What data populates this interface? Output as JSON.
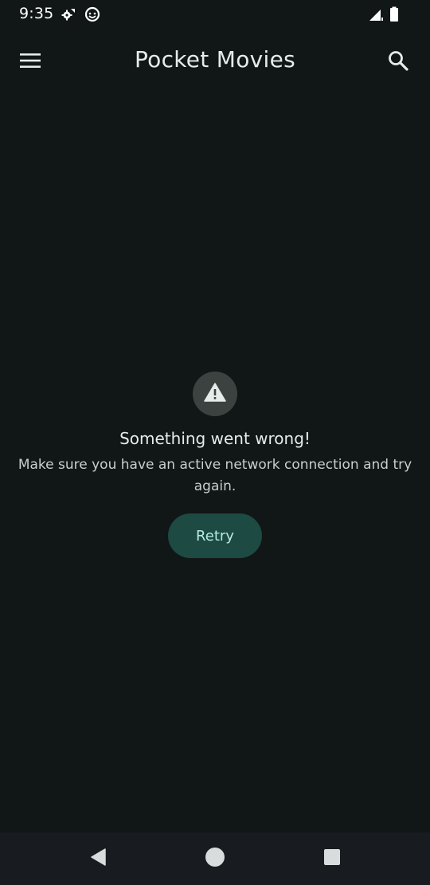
{
  "status_bar": {
    "time": "9:35",
    "icons": [
      "settings-sync-icon",
      "smiley-icon",
      "signal-icon",
      "battery-icon"
    ]
  },
  "app_bar": {
    "title": "Pocket Movies",
    "menu_icon": "hamburger-menu-icon",
    "search_icon": "search-icon"
  },
  "error": {
    "icon": "warning-icon",
    "title": "Something went wrong!",
    "message": "Make sure you have an active network connection and try again.",
    "retry_label": "Retry"
  },
  "nav_bar": {
    "buttons": [
      "back-icon",
      "home-icon",
      "recents-icon"
    ]
  },
  "colors": {
    "background": "#111616",
    "accent_button": "#1d4a43",
    "accent_text": "#b5ecde",
    "nav_background": "#181b1f"
  }
}
